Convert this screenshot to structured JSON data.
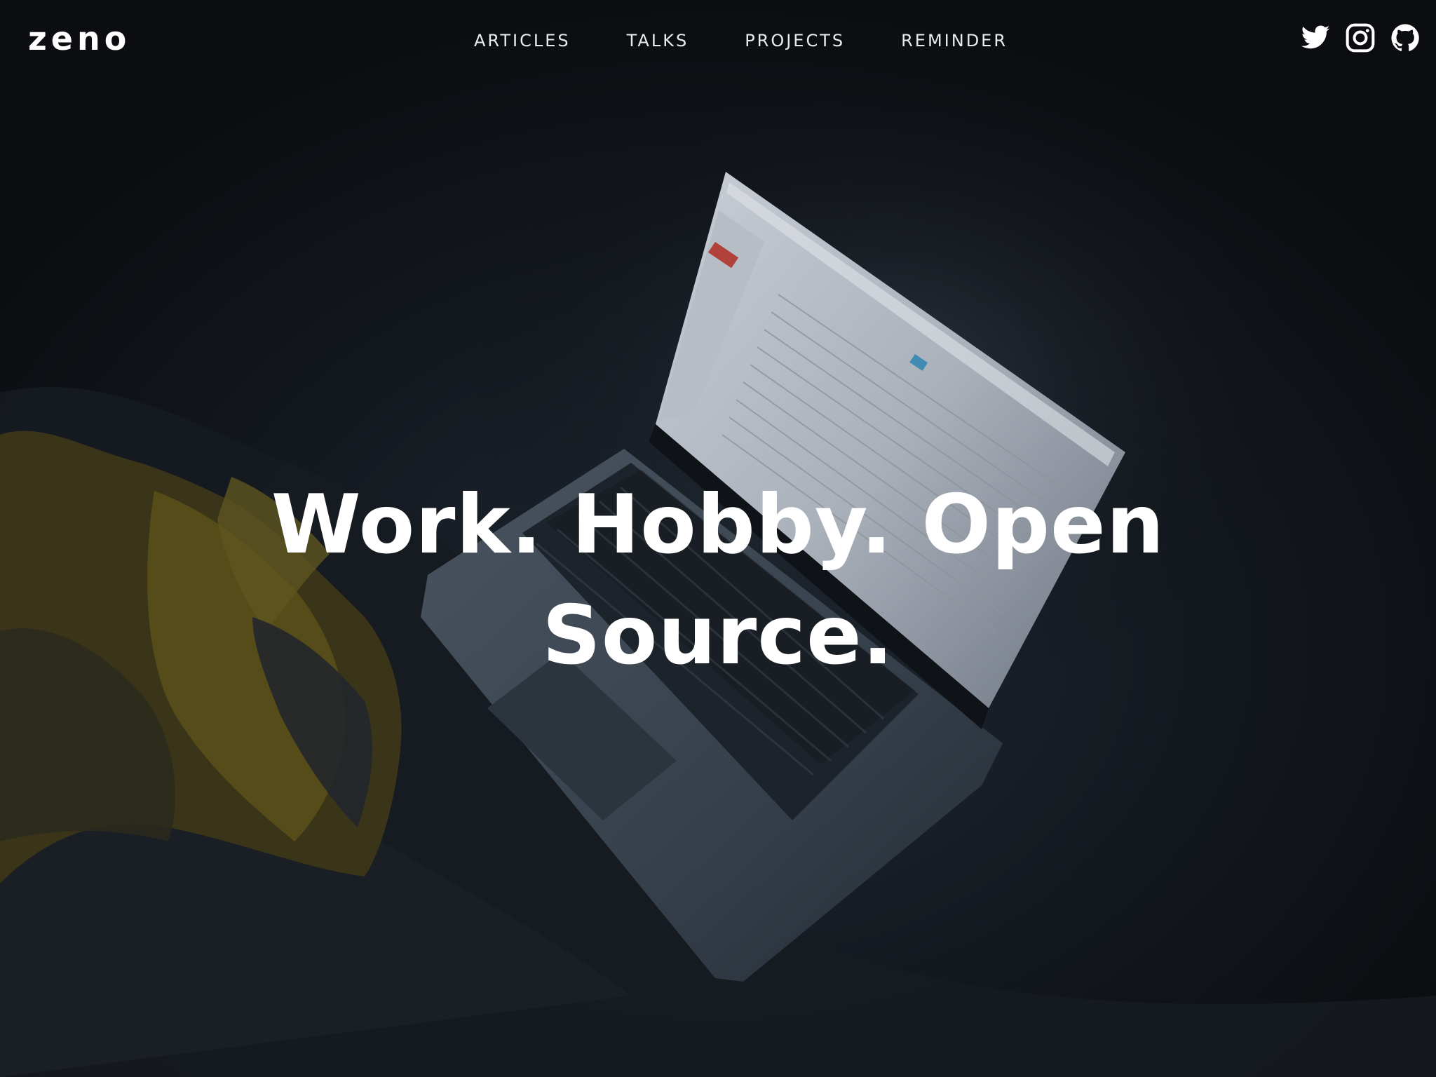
{
  "header": {
    "logo": "zeno",
    "nav": [
      "ARTICLES",
      "TALKS",
      "PROJECTS",
      "REMINDER"
    ],
    "social_icons": [
      "twitter-icon",
      "instagram-icon",
      "github-icon"
    ]
  },
  "hero": {
    "headline": "Work. Hobby. Open Source.",
    "background": "laptop-on-bed-photo"
  },
  "colors": {
    "background": "#0b0d10",
    "text": "#ffffff",
    "nav_text": "#e9ecef"
  }
}
